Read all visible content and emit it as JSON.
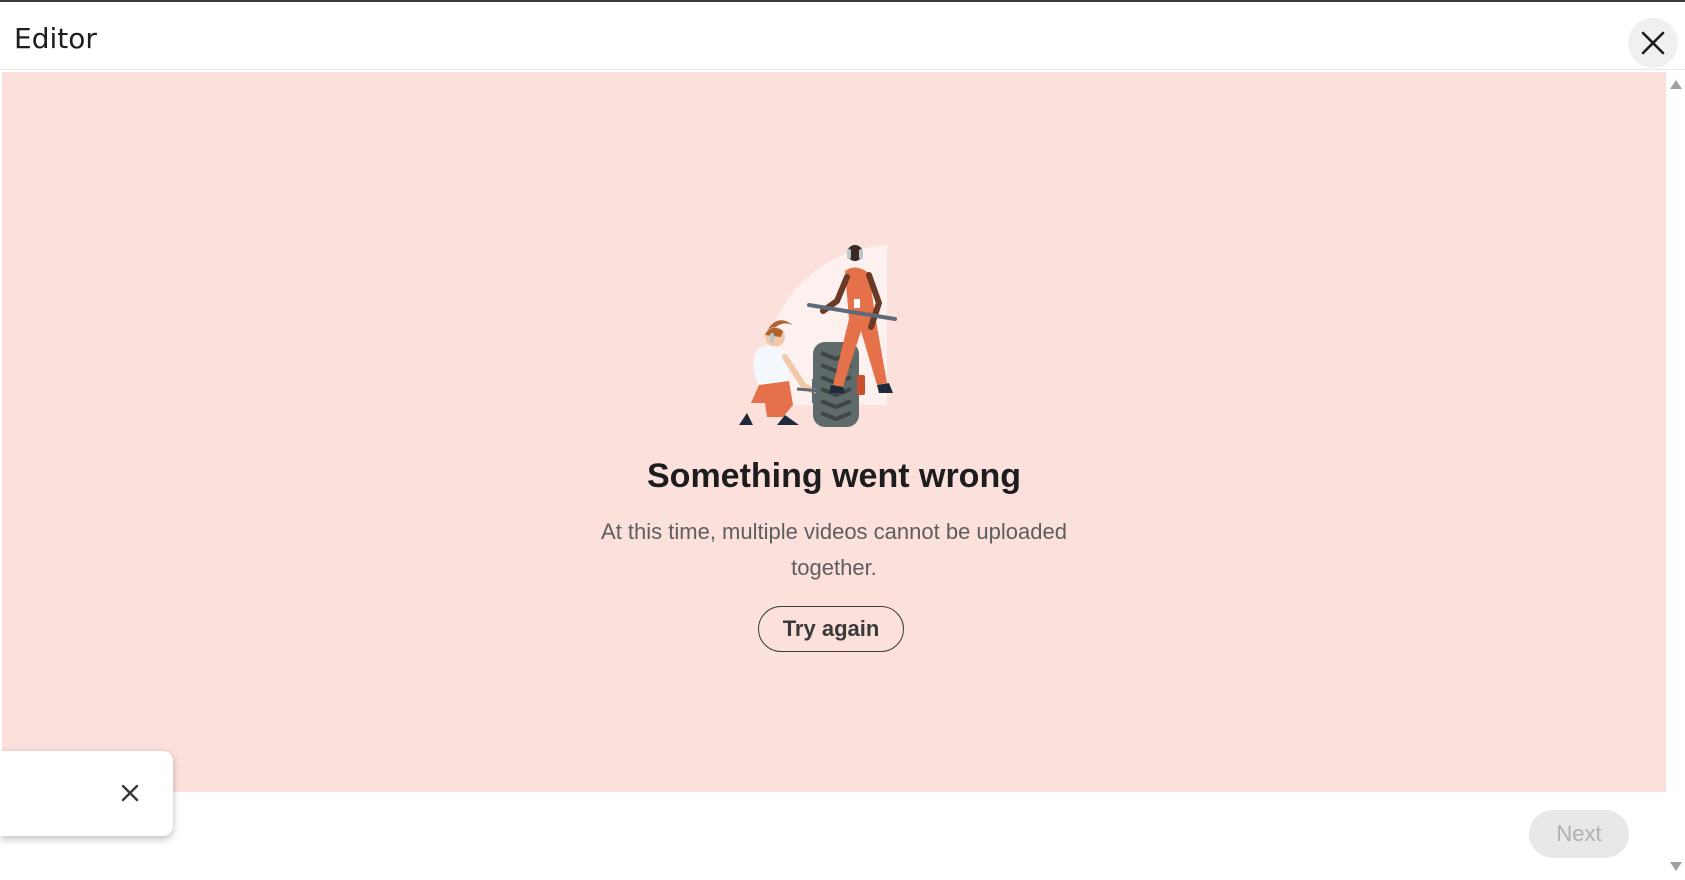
{
  "dialog": {
    "title": "Editor",
    "close_icon": "close-icon"
  },
  "error": {
    "heading": "Something went wrong",
    "message": "At this time, multiple videos cannot be uploaded together.",
    "retry_label": "Try again",
    "illustration": "pit-crew-tire-change-illustration"
  },
  "toast": {
    "close_icon": "close-icon"
  },
  "footer": {
    "next_label": "Next",
    "next_enabled": false
  },
  "colors": {
    "content_background": "#fbe0dc",
    "accent_orange": "#e4714a"
  }
}
